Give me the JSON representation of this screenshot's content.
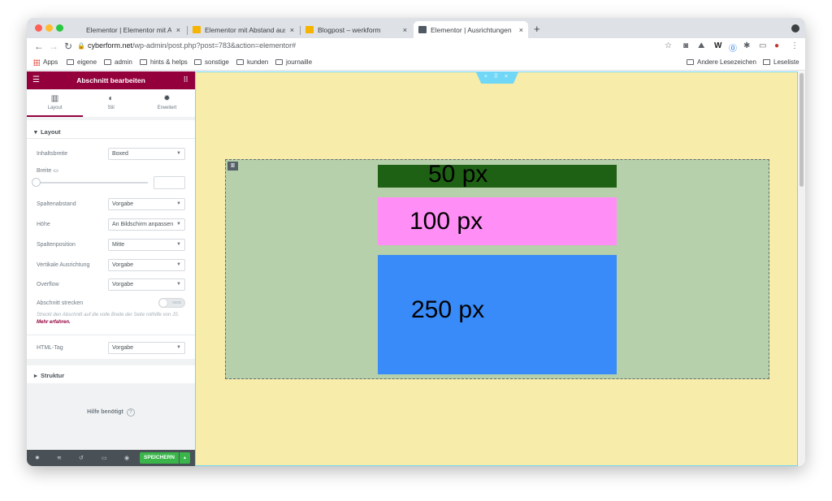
{
  "browser": {
    "tabs": [
      {
        "title": "Elementor | Elementor mit Abst",
        "close": "×",
        "favicon_color": "#4f5a65",
        "active": false
      },
      {
        "title": "Elementor mit Abstand ausgeri",
        "close": "×",
        "favicon_color": "#f4b400",
        "active": false
      },
      {
        "title": "Blogpost – werkform",
        "close": "×",
        "favicon_color": "#f4b400",
        "active": false
      },
      {
        "title": "Elementor | Ausrichtungen",
        "close": "×",
        "favicon_color": "#4f5a65",
        "active": true
      }
    ],
    "new_tab": "+",
    "url_host": "cyberform.net",
    "url_path": "/wp-admin/post.php?post=783&action=elementor#",
    "bookmarks": [
      "Apps",
      "eigene",
      "admin",
      "hints & helps",
      "sonstige",
      "kunden",
      "journaille"
    ],
    "bookmarks_right": [
      "Andere Lesezeichen",
      "Leseliste"
    ]
  },
  "panel": {
    "title": "Abschnitt bearbeiten",
    "tabs": [
      {
        "label": "Layout",
        "icon": "▥"
      },
      {
        "label": "Stil",
        "icon": "◐"
      },
      {
        "label": "Erweitert",
        "icon": "✹"
      }
    ],
    "section_layout": "Layout",
    "fields": {
      "inhaltsbreite": {
        "label": "Inhaltsbreite",
        "value": "Boxed"
      },
      "breite": {
        "label": "Breite"
      },
      "spaltenabstand": {
        "label": "Spaltenabstand",
        "value": "Vorgabe"
      },
      "hoehe": {
        "label": "Höhe",
        "value": "An Bildschirm anpassen"
      },
      "spaltenposition": {
        "label": "Spaltenposition",
        "value": "Mitte"
      },
      "vertikale": {
        "label": "Vertikale Ausrichtung",
        "value": "Vorgabe"
      },
      "overflow": {
        "label": "Overflow",
        "value": "Vorgabe"
      },
      "strecken": {
        "label": "Abschnitt strecken",
        "toggle": "NEIN"
      },
      "html_tag": {
        "label": "HTML-Tag",
        "value": "Vorgabe"
      }
    },
    "desc": "Streckt den Abschnitt auf die volle Breite der Seite mithilfe von JS.",
    "desc_link": "Mehr erfahren.",
    "section_struktur": "Struktur",
    "help": "Hilfe benötigt",
    "save": "SPEICHERN",
    "accent": "#93003c"
  },
  "preview": {
    "background": "#f7ecaa",
    "section_bg": "#b5d0aa",
    "boxes": [
      {
        "label": "50 px",
        "color": "#1e6114"
      },
      {
        "label": "100 px",
        "color": "#ff8ef7"
      },
      {
        "label": "250 px",
        "color": "#388bf8"
      }
    ]
  }
}
